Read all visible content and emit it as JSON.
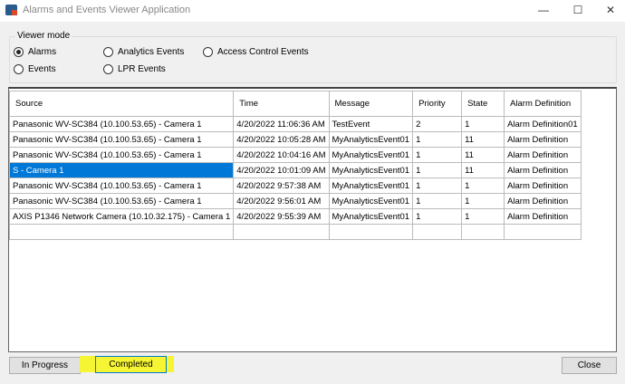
{
  "window": {
    "title": "Alarms and Events Viewer Application",
    "minimize": "—",
    "maximize": "☐",
    "close": "✕"
  },
  "viewer_mode": {
    "label": "Viewer mode",
    "selected": "Alarms",
    "options": [
      "Alarms",
      "Events",
      "Analytics Events",
      "LPR Events",
      "Access Control Events"
    ]
  },
  "grid": {
    "columns": [
      "Source",
      "Time",
      "Message",
      "Priority",
      "State",
      "Alarm Definition"
    ],
    "selected_row": 3,
    "rows": [
      [
        "Panasonic WV-SC384 (10.100.53.65) - Camera 1",
        "4/20/2022 11:06:36 AM",
        "TestEvent",
        "2",
        "1",
        "Alarm Definition01"
      ],
      [
        "Panasonic WV-SC384 (10.100.53.65) - Camera 1",
        "4/20/2022 10:05:28 AM",
        "MyAnalyticsEvent01",
        "1",
        "11",
        "Alarm Definition"
      ],
      [
        "Panasonic WV-SC384 (10.100.53.65) - Camera 1",
        "4/20/2022 10:04:16 AM",
        "MyAnalyticsEvent01",
        "1",
        "11",
        "Alarm Definition"
      ],
      [
        "S - Camera 1",
        "4/20/2022 10:01:09 AM",
        "MyAnalyticsEvent01",
        "1",
        "11",
        "Alarm Definition"
      ],
      [
        "Panasonic WV-SC384 (10.100.53.65) - Camera 1",
        "4/20/2022 9:57:38 AM",
        "MyAnalyticsEvent01",
        "1",
        "1",
        "Alarm Definition"
      ],
      [
        "Panasonic WV-SC384 (10.100.53.65) - Camera 1",
        "4/20/2022 9:56:01 AM",
        "MyAnalyticsEvent01",
        "1",
        "1",
        "Alarm Definition"
      ],
      [
        "AXIS P1346 Network Camera (10.10.32.175) - Camera 1",
        "4/20/2022 9:55:39 AM",
        "MyAnalyticsEvent01",
        "1",
        "1",
        "Alarm Definition"
      ]
    ]
  },
  "buttons": {
    "in_progress": "In Progress",
    "completed": "Completed",
    "close": "Close"
  },
  "colors": {
    "selection": "#0078d7",
    "highlight": "#f5f534"
  }
}
